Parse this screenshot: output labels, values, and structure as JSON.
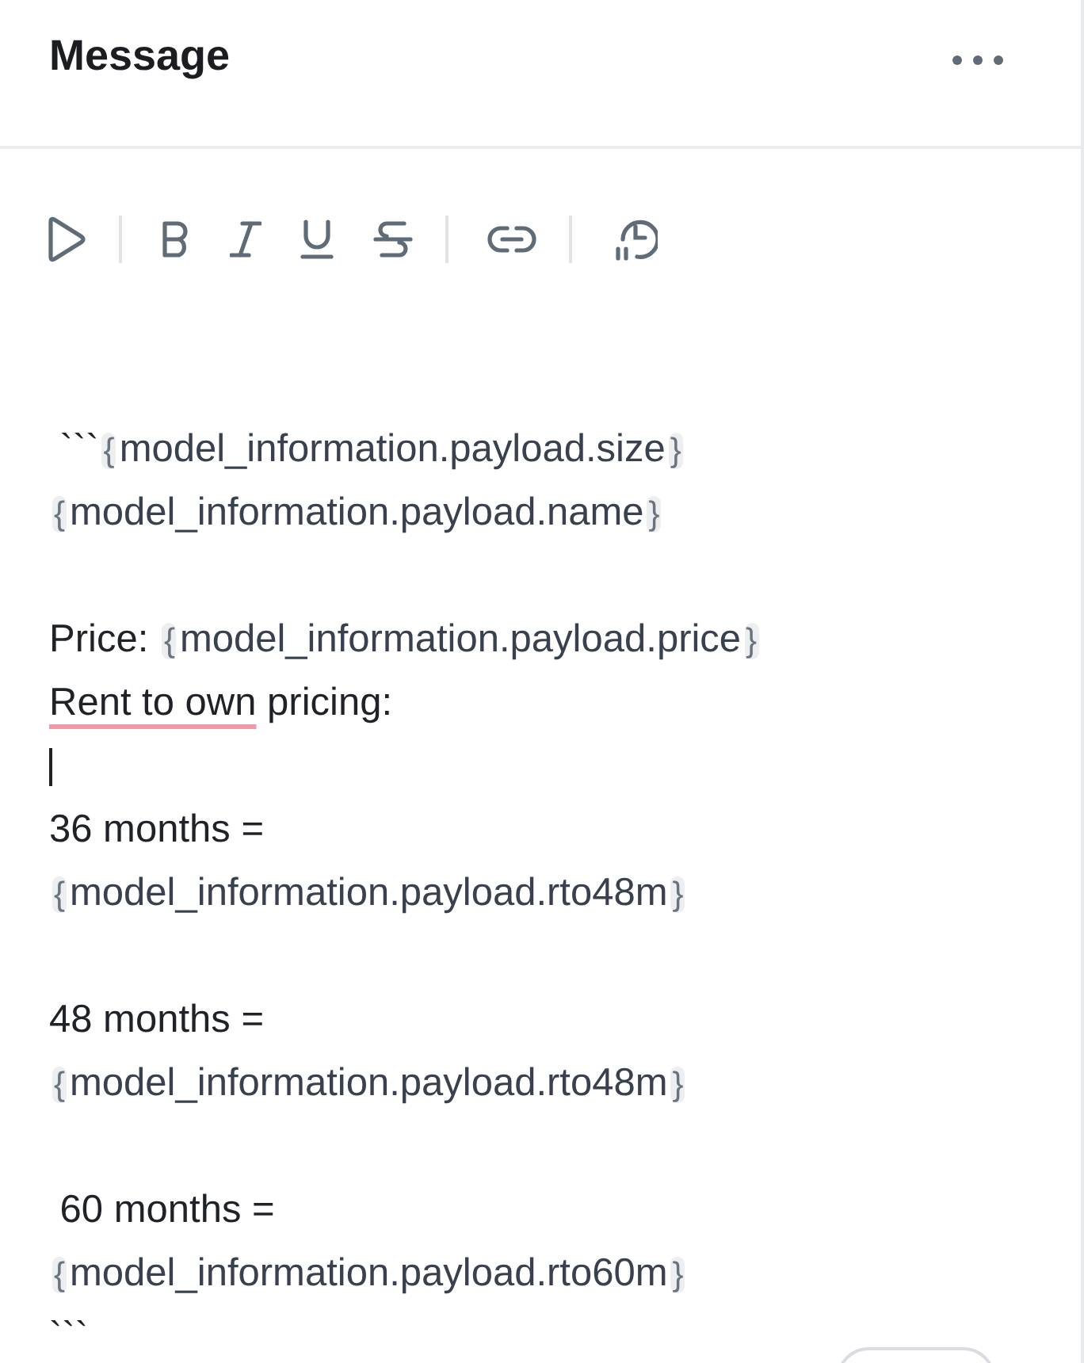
{
  "header": {
    "title": "Message"
  },
  "lines": [
    {
      "kind": "text",
      "segments": [
        {
          "kind": "text",
          "text": " ```"
        },
        {
          "kind": "variable",
          "open": "{",
          "name": "model_information.payload.size",
          "close": "}"
        }
      ]
    },
    {
      "kind": "text",
      "segments": [
        {
          "kind": "variable",
          "open": "{",
          "name": "model_information.payload.name",
          "close": "}"
        }
      ]
    },
    {
      "kind": "blank"
    },
    {
      "kind": "text",
      "segments": [
        {
          "kind": "text",
          "text": "Price: "
        },
        {
          "kind": "variable",
          "open": "{",
          "name": "model_information.payload.price",
          "close": "}"
        }
      ]
    },
    {
      "kind": "text",
      "segments": [
        {
          "kind": "misspelled",
          "text": "Rent to own"
        },
        {
          "kind": "text",
          "text": " pricing:"
        }
      ]
    },
    {
      "kind": "cursor"
    },
    {
      "kind": "text",
      "segments": [
        {
          "kind": "text",
          "text": "36 months ="
        }
      ]
    },
    {
      "kind": "text",
      "segments": [
        {
          "kind": "variable",
          "open": "{",
          "name": "model_information.payload.rto48m",
          "close": "}"
        }
      ]
    },
    {
      "kind": "blank"
    },
    {
      "kind": "text",
      "segments": [
        {
          "kind": "text",
          "text": "48 months ="
        }
      ]
    },
    {
      "kind": "text",
      "segments": [
        {
          "kind": "variable",
          "open": "{",
          "name": "model_information.payload.rto48m",
          "close": "}"
        }
      ]
    },
    {
      "kind": "blank"
    },
    {
      "kind": "text",
      "segments": [
        {
          "kind": "text",
          "text": " 60 months ="
        }
      ]
    },
    {
      "kind": "text",
      "segments": [
        {
          "kind": "variable",
          "open": "{",
          "name": "model_information.payload.rto60m",
          "close": "}"
        }
      ]
    },
    {
      "kind": "text",
      "segments": [
        {
          "kind": "text",
          "text": "```"
        }
      ]
    }
  ]
}
